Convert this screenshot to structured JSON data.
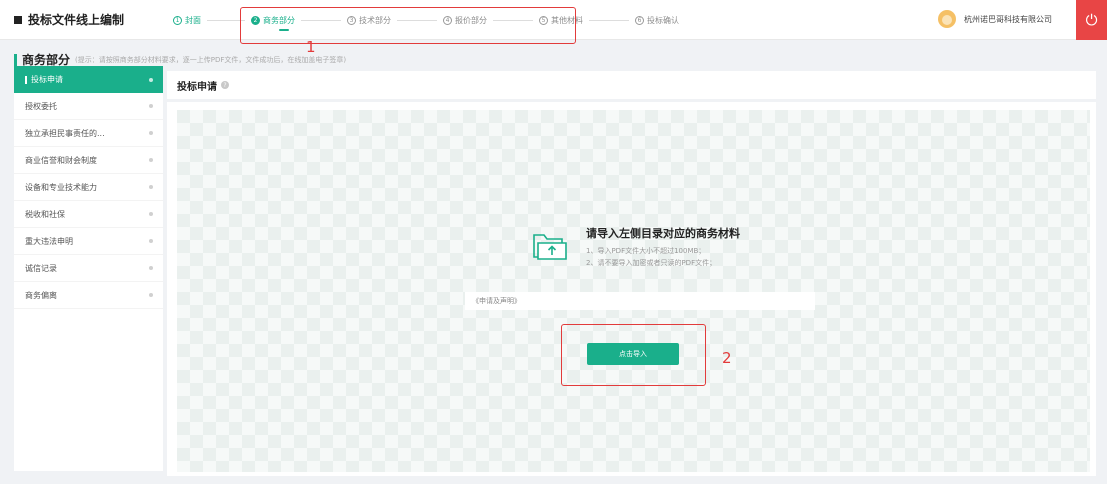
{
  "header": {
    "app_title": "投标文件线上编制",
    "steps": [
      {
        "num": "1",
        "label": "封面",
        "state": "done"
      },
      {
        "num": "2",
        "label": "商务部分",
        "state": "active"
      },
      {
        "num": "3",
        "label": "技术部分",
        "state": "todo"
      },
      {
        "num": "4",
        "label": "报价部分",
        "state": "todo"
      },
      {
        "num": "5",
        "label": "其他材料",
        "state": "todo"
      },
      {
        "num": "6",
        "label": "投标确认",
        "state": "todo"
      }
    ],
    "company": "杭州诺巴哥科技有限公司",
    "power_icon": "power-icon"
  },
  "annotations": {
    "label1": "1",
    "label2": "2",
    "color": "#e23b3b"
  },
  "section": {
    "title": "商务部分",
    "hint": "(提示：请按照商务部分材料要求，逐一上传PDF文件，文件成功后，在线加盖电子签章)"
  },
  "sidebar": {
    "items": [
      {
        "label": "投标申请",
        "active": true
      },
      {
        "label": "授权委托",
        "active": false
      },
      {
        "label": "独立承担民事责任的...",
        "active": false
      },
      {
        "label": "商业信誉和财会制度",
        "active": false
      },
      {
        "label": "设备和专业技术能力",
        "active": false
      },
      {
        "label": "税收和社保",
        "active": false
      },
      {
        "label": "重大违法申明",
        "active": false
      },
      {
        "label": "诚信记录",
        "active": false
      },
      {
        "label": "商务偏离",
        "active": false
      }
    ]
  },
  "main": {
    "heading": "投标申请",
    "prompt_title": "请导入左侧目录对应的商务材料",
    "prompt_lines": [
      "1、导入PDF文件大小不超过100MB；",
      "2、请不要导入加密或者只读的PDF文件；"
    ],
    "doc_name": "《申请及声明》",
    "import_button": "点击导入"
  },
  "colors": {
    "accent": "#1aaf8b",
    "danger": "#e84545"
  }
}
